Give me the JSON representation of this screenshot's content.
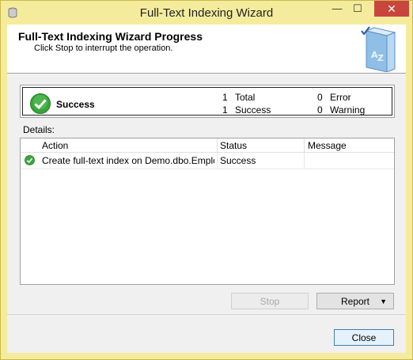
{
  "window": {
    "title": "Full-Text Indexing Wizard",
    "title_controls": {
      "minimize": "—",
      "maximize": "☐",
      "close": "✕"
    }
  },
  "header": {
    "title": "Full-Text Indexing Wizard Progress",
    "subtitle": "Click Stop to interrupt the operation."
  },
  "summary": {
    "status": "Success",
    "total_count": "1",
    "total_label": "Total",
    "success_count": "1",
    "success_label": "Success",
    "error_count": "0",
    "error_label": "Error",
    "warning_count": "0",
    "warning_label": "Warning"
  },
  "details": {
    "label": "Details:",
    "columns": [
      "Action",
      "Status",
      "Message"
    ],
    "rows": [
      {
        "action": "Create full-text index on Demo.dbo.Employ...",
        "status": "Success",
        "message": ""
      }
    ]
  },
  "buttons": {
    "stop": "Stop",
    "report": "Report",
    "close": "Close"
  },
  "colors": {
    "title_bar": "#f4ec9c",
    "close_button": "#c9463d",
    "success_green": "#3aa53a"
  },
  "icons": {
    "app": "database-icon",
    "header": "book-icon",
    "status": "check-circle-icon"
  }
}
